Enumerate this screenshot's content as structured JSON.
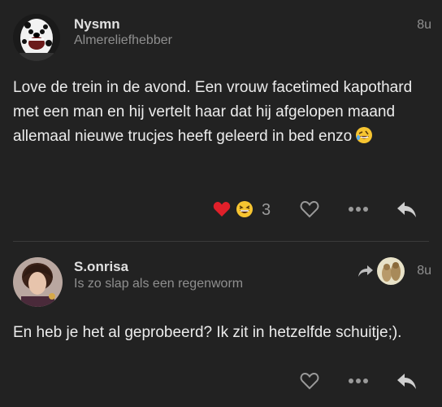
{
  "posts": [
    {
      "username": "Nysmn",
      "user_title": "Almereliefhebber",
      "time": "8u",
      "body": "Love de trein in de avond. Een vrouw facetimed kapothard met een man en hij vertelt haar dat hij afgelopen maand allemaal nieuwe trucjes heeft geleerd in bed enzo",
      "body_emoji": "rolling-on-floor-laughing",
      "reactions": {
        "emojis": [
          "red-heart",
          "grinning-squinting-face"
        ],
        "count": "3"
      },
      "actions": [
        "like-heart-icon",
        "more-ellipsis-icon",
        "reply-icon"
      ]
    },
    {
      "username": "S.onrisa",
      "user_title": "Is zo slap als een regenworm",
      "time": "8u",
      "reply_indicator": "share-arrow-icon",
      "body": "En heb je het al geprobeerd? Ik zit in hetzelfde schuitje;).",
      "actions": [
        "like-heart-icon",
        "more-ellipsis-icon",
        "reply-icon"
      ]
    }
  ],
  "colors": {
    "background": "#222222",
    "text": "#ececec",
    "muted": "#8f8f8f",
    "divider": "#3a3a3a",
    "heart": "#e0202a"
  }
}
